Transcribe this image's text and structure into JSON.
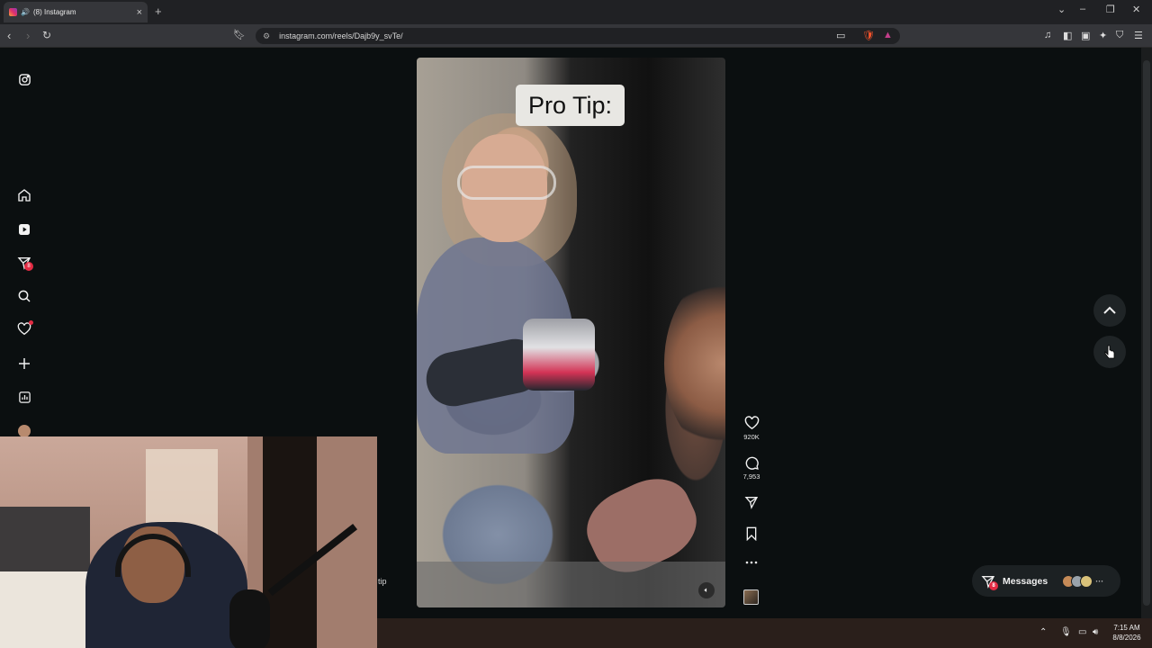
{
  "browser": {
    "tab_title": "(8) Instagram",
    "new_tab_symbol": "+",
    "url": "instagram.com/reels/Dajb9y_svTe/"
  },
  "sidebar": {
    "messages_badge": "8"
  },
  "reel": {
    "caption_overlay": "Pro Tip:",
    "likes": "920K",
    "comments": "7,953",
    "partial_caption": "tip"
  },
  "messages_pill": {
    "label": "Messages",
    "badge": "8",
    "avatar_colors": [
      "#c58a57",
      "#9aa3ab",
      "#d9c27a"
    ]
  },
  "taskbar": {
    "time": "7:15 AM",
    "date": "8/8/2026"
  },
  "colors": {
    "badge_red": "#e22b43",
    "background": "#0b0f10"
  }
}
